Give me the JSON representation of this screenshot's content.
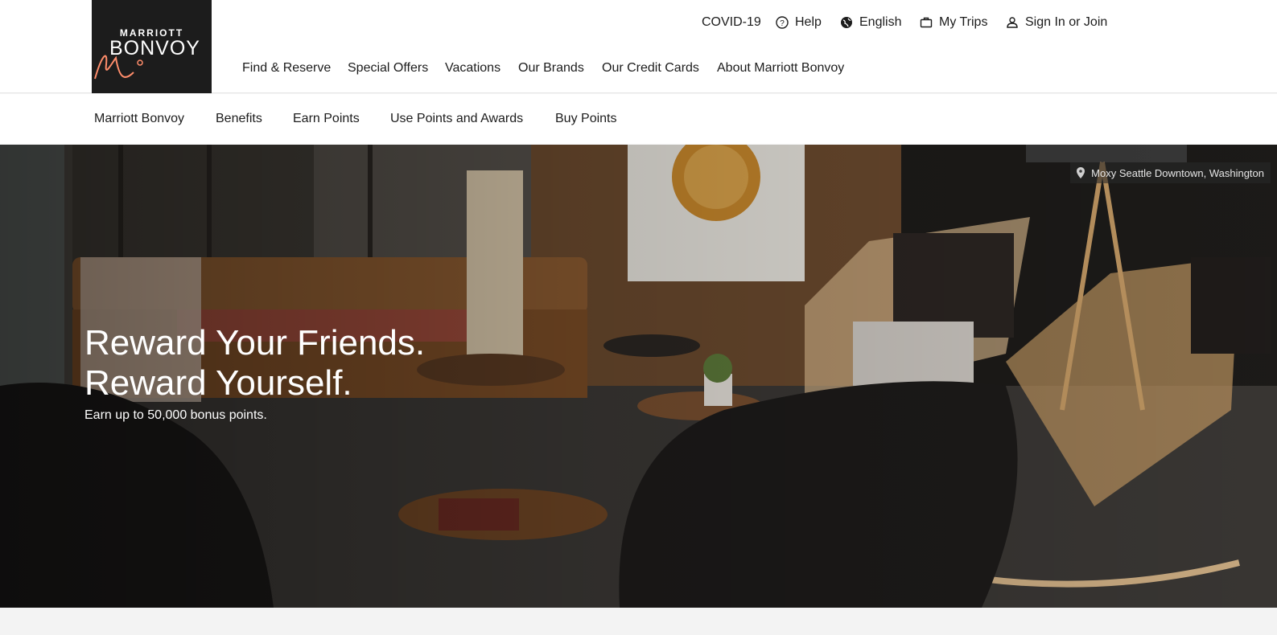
{
  "brand": {
    "line1": "MARRIOTT",
    "line2": "BONVOY"
  },
  "utility_nav": {
    "covid": "COVID-19",
    "help": "Help",
    "language": "English",
    "trips": "My Trips",
    "signin": "Sign In or Join"
  },
  "main_nav": [
    "Find & Reserve",
    "Special Offers",
    "Vacations",
    "Our Brands",
    "Our Credit Cards",
    "About Marriott Bonvoy"
  ],
  "sub_nav": [
    "Marriott Bonvoy",
    "Benefits",
    "Earn Points",
    "Use Points and Awards",
    "Buy Points"
  ],
  "hero": {
    "headline_1": "Reward Your Friends.",
    "headline_2": "Reward Yourself.",
    "subtext": "Earn up to 50,000 bonus points.",
    "location": "Moxy Seattle Downtown, Washington"
  },
  "colors": {
    "logo_bg": "#1c1c1c",
    "accent": "#ff8d6b",
    "text": "#1c1c1c"
  }
}
